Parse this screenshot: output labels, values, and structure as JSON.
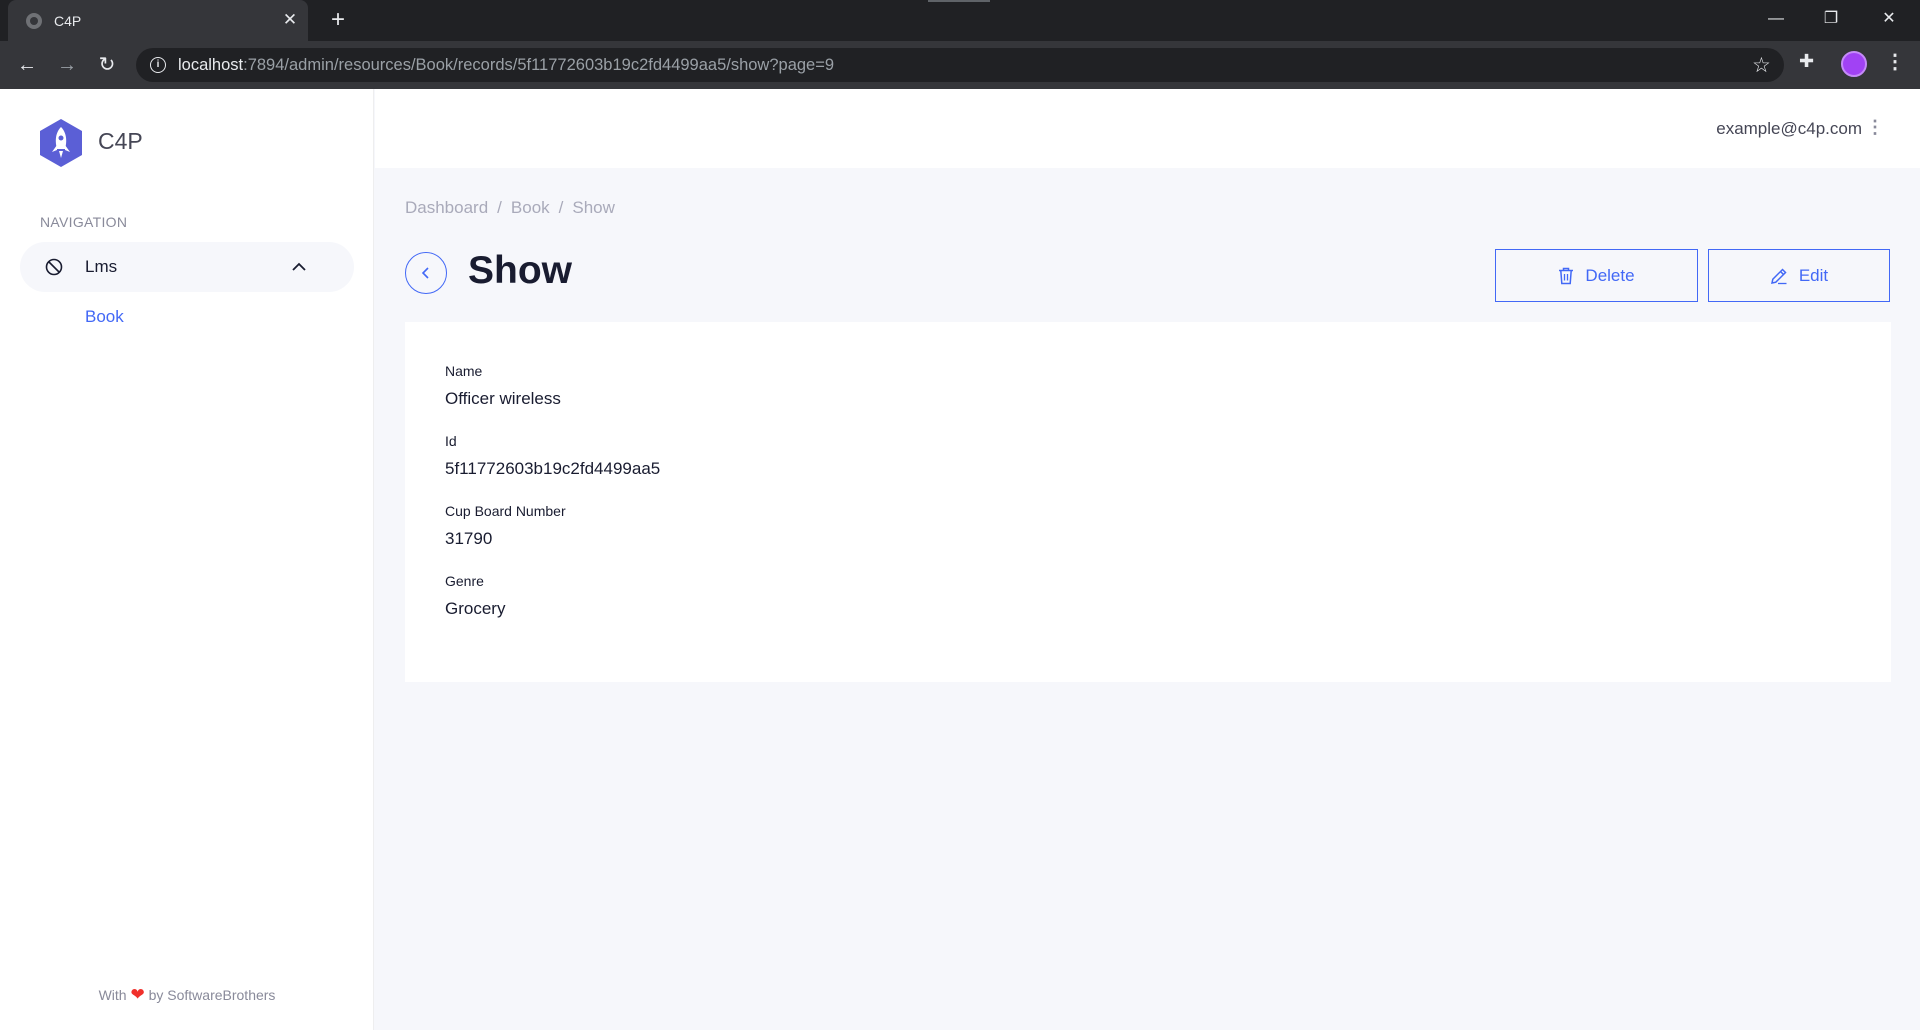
{
  "browser": {
    "tab_title": "C4P",
    "url_host": "localhost",
    "url_rest": ":7894/admin/resources/Book/records/5f11772603b19c2fd4499aa5/show?page=9"
  },
  "sidebar": {
    "brand": "C4P",
    "nav_heading": "NAVIGATION",
    "group_label": "Lms",
    "items": [
      {
        "label": "Book"
      }
    ],
    "footer_prefix": "With",
    "footer_suffix": "by SoftwareBrothers"
  },
  "topbar": {
    "user_email": "example@c4p.com"
  },
  "breadcrumb": [
    "Dashboard",
    "Book",
    "Show"
  ],
  "page": {
    "title": "Show",
    "delete_label": "Delete",
    "edit_label": "Edit"
  },
  "record": {
    "fields": [
      {
        "label": "Name",
        "value": "Officer wireless"
      },
      {
        "label": "Id",
        "value": "5f11772603b19c2fd4499aa5"
      },
      {
        "label": "Cup Board Number",
        "value": "31790"
      },
      {
        "label": "Genre",
        "value": "Grocery"
      }
    ]
  },
  "colors": {
    "accent": "#4268f6",
    "heart": "#f0302b",
    "brand": "#5b5fd6"
  }
}
